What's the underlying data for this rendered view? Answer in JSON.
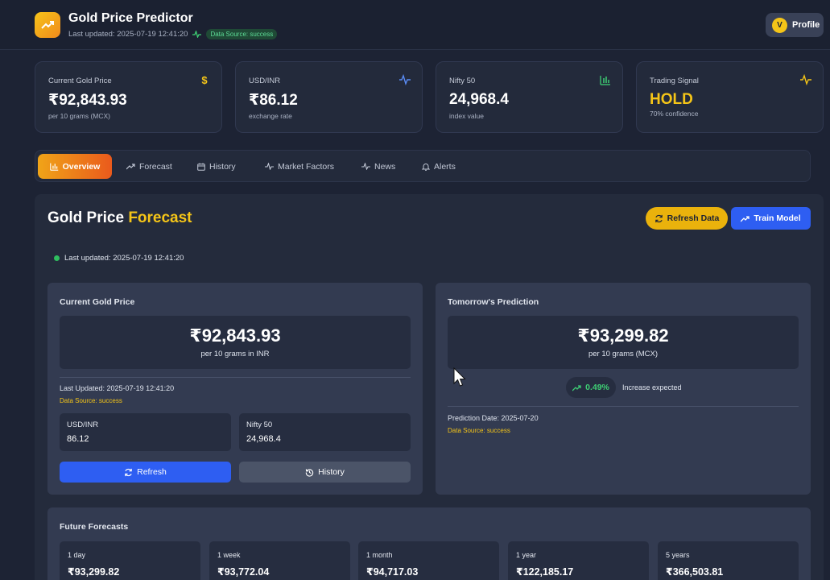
{
  "header": {
    "title": "Gold Price Predictor",
    "last_updated": "Last updated: 2025-07-19 12:41:20",
    "data_source_badge": "Data Source: success",
    "profile_initial": "V",
    "profile_label": "Profile"
  },
  "stats": [
    {
      "label": "Current Gold Price",
      "value": "₹92,843.93",
      "sub": "per 10 grams (MCX)",
      "icon": "dollar-icon",
      "color": "#f5c518"
    },
    {
      "label": "USD/INR",
      "value": "₹86.12",
      "sub": "exchange rate",
      "icon": "activity-icon",
      "color": "#5b8cf5"
    },
    {
      "label": "Nifty 50",
      "value": "24,968.4",
      "sub": "index value",
      "icon": "bar-chart-icon",
      "color": "#3ecf74"
    },
    {
      "label": "Trading Signal",
      "value": "HOLD",
      "sub": "70% confidence",
      "icon": "activity-icon",
      "color": "#f5c518"
    }
  ],
  "tabs": [
    {
      "label": "Overview",
      "icon": "bar-chart-icon",
      "active": true
    },
    {
      "label": "Forecast",
      "icon": "trending-up-icon"
    },
    {
      "label": "History",
      "icon": "calendar-icon"
    },
    {
      "label": "Market Factors",
      "icon": "activity-icon"
    },
    {
      "label": "News",
      "icon": "activity-icon"
    },
    {
      "label": "Alerts",
      "icon": "bell-icon"
    }
  ],
  "main": {
    "title_prefix": "Gold Price",
    "title_accent": "Forecast",
    "refresh_data_label": "Refresh Data",
    "train_model_label": "Train Model",
    "last_updated": "Last updated: 2025-07-19 12:41:20"
  },
  "current": {
    "title": "Current Gold Price",
    "price": "₹92,843.93",
    "unit": "per 10 grams in INR",
    "last_updated": "Last Updated: 2025-07-19 12:41:20",
    "data_source": "Data Source: success",
    "usd_inr_label": "USD/INR",
    "usd_inr_value": "86.12",
    "nifty_label": "Nifty 50",
    "nifty_value": "24,968.4",
    "refresh_label": "Refresh",
    "history_label": "History"
  },
  "prediction": {
    "title": "Tomorrow's Prediction",
    "price": "₹93,299.82",
    "unit": "per 10 grams (MCX)",
    "change": "0.49%",
    "change_text": "Increase expected",
    "date": "Prediction Date: 2025-07-20",
    "data_source": "Data Source: success"
  },
  "future": {
    "title": "Future Forecasts",
    "items": [
      {
        "label": "1 day",
        "value": "₹93,299.82"
      },
      {
        "label": "1 week",
        "value": "₹93,772.04"
      },
      {
        "label": "1 month",
        "value": "₹94,717.03"
      },
      {
        "label": "1 year",
        "value": "₹122,185.17"
      },
      {
        "label": "5 years",
        "value": "₹366,503.81"
      }
    ]
  },
  "colors": {
    "accent_gold": "#f5c518",
    "primary_blue": "#2e5ef2",
    "success_green": "#3ecf74"
  }
}
